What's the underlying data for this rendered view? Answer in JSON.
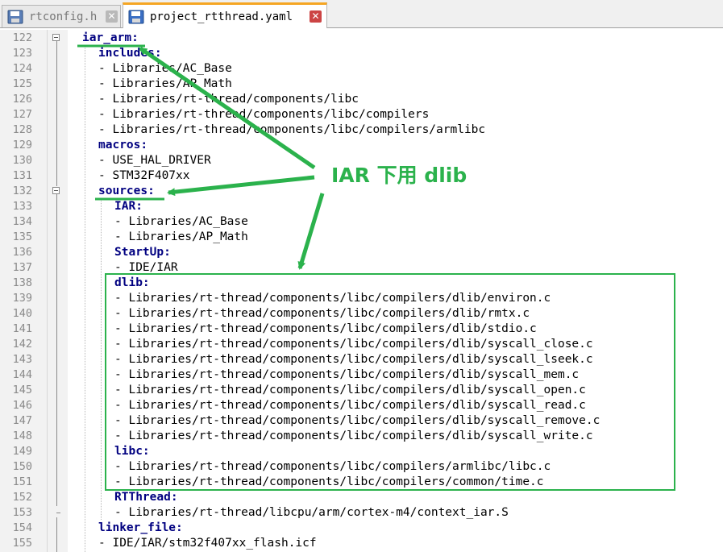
{
  "tabs": [
    {
      "label": "rtconfig.h",
      "active": false
    },
    {
      "label": "project_rtthread.yaml",
      "active": true
    }
  ],
  "editor": {
    "lines": [
      {
        "num": "122",
        "indent": 0,
        "text": "iar_arm:",
        "key": true
      },
      {
        "num": "123",
        "indent": 1,
        "text": "includes:",
        "key": true
      },
      {
        "num": "124",
        "indent": 1,
        "text": "- Libraries/AC_Base",
        "key": false
      },
      {
        "num": "125",
        "indent": 1,
        "text": "- Libraries/AP_Math",
        "key": false
      },
      {
        "num": "126",
        "indent": 1,
        "text": "- Libraries/rt-thread/components/libc",
        "key": false
      },
      {
        "num": "127",
        "indent": 1,
        "text": "- Libraries/rt-thread/components/libc/compilers",
        "key": false
      },
      {
        "num": "128",
        "indent": 1,
        "text": "- Libraries/rt-thread/components/libc/compilers/armlibc",
        "key": false
      },
      {
        "num": "129",
        "indent": 1,
        "text": "macros:",
        "key": true
      },
      {
        "num": "130",
        "indent": 1,
        "text": "- USE_HAL_DRIVER",
        "key": false
      },
      {
        "num": "131",
        "indent": 1,
        "text": "- STM32F407xx",
        "key": false
      },
      {
        "num": "132",
        "indent": 1,
        "text": "sources:",
        "key": true
      },
      {
        "num": "133",
        "indent": 2,
        "text": "IAR:",
        "key": true
      },
      {
        "num": "134",
        "indent": 2,
        "text": "- Libraries/AC_Base",
        "key": false
      },
      {
        "num": "135",
        "indent": 2,
        "text": "- Libraries/AP_Math",
        "key": false
      },
      {
        "num": "136",
        "indent": 2,
        "text": "StartUp:",
        "key": true
      },
      {
        "num": "137",
        "indent": 2,
        "text": "- IDE/IAR",
        "key": false
      },
      {
        "num": "138",
        "indent": 2,
        "text": "dlib:",
        "key": true
      },
      {
        "num": "139",
        "indent": 2,
        "text": "- Libraries/rt-thread/components/libc/compilers/dlib/environ.c",
        "key": false
      },
      {
        "num": "140",
        "indent": 2,
        "text": "- Libraries/rt-thread/components/libc/compilers/dlib/rmtx.c",
        "key": false
      },
      {
        "num": "141",
        "indent": 2,
        "text": "- Libraries/rt-thread/components/libc/compilers/dlib/stdio.c",
        "key": false
      },
      {
        "num": "142",
        "indent": 2,
        "text": "- Libraries/rt-thread/components/libc/compilers/dlib/syscall_close.c",
        "key": false
      },
      {
        "num": "143",
        "indent": 2,
        "text": "- Libraries/rt-thread/components/libc/compilers/dlib/syscall_lseek.c",
        "key": false
      },
      {
        "num": "144",
        "indent": 2,
        "text": "- Libraries/rt-thread/components/libc/compilers/dlib/syscall_mem.c",
        "key": false
      },
      {
        "num": "145",
        "indent": 2,
        "text": "- Libraries/rt-thread/components/libc/compilers/dlib/syscall_open.c",
        "key": false
      },
      {
        "num": "146",
        "indent": 2,
        "text": "- Libraries/rt-thread/components/libc/compilers/dlib/syscall_read.c",
        "key": false
      },
      {
        "num": "147",
        "indent": 2,
        "text": "- Libraries/rt-thread/components/libc/compilers/dlib/syscall_remove.c",
        "key": false
      },
      {
        "num": "148",
        "indent": 2,
        "text": "- Libraries/rt-thread/components/libc/compilers/dlib/syscall_write.c",
        "key": false
      },
      {
        "num": "149",
        "indent": 2,
        "text": "libc:",
        "key": true
      },
      {
        "num": "150",
        "indent": 2,
        "text": "- Libraries/rt-thread/components/libc/compilers/armlibc/libc.c",
        "key": false
      },
      {
        "num": "151",
        "indent": 2,
        "text": "- Libraries/rt-thread/components/libc/compilers/common/time.c",
        "key": false
      },
      {
        "num": "152",
        "indent": 2,
        "text": "RTThread:",
        "key": true
      },
      {
        "num": "153",
        "indent": 2,
        "text": "- Libraries/rt-thread/libcpu/arm/cortex-m4/context_iar.S",
        "key": false
      },
      {
        "num": "154",
        "indent": 1,
        "text": "linker_file:",
        "key": true
      },
      {
        "num": "155",
        "indent": 1,
        "text": "- IDE/IAR/stm32f407xx_flash.icf",
        "key": false
      }
    ]
  },
  "annotation": {
    "label": "IAR 下用 dlib",
    "color": "#2bb24c"
  }
}
